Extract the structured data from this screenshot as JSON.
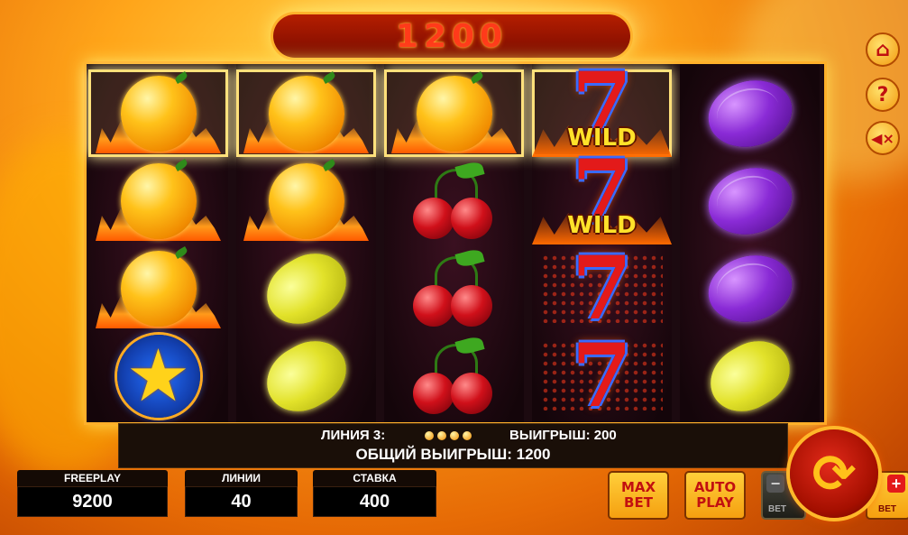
{
  "top_win": "1200",
  "reels": [
    [
      "orange-fire",
      "orange-fire",
      "orange-fire",
      "star"
    ],
    [
      "orange-fire",
      "orange-fire",
      "lemon",
      "lemon"
    ],
    [
      "orange-fire",
      "cherry",
      "cherry",
      "cherry"
    ],
    [
      "seven-wild",
      "seven-wild",
      "seven",
      "seven"
    ],
    [
      "plum",
      "plum",
      "plum",
      "lemon"
    ]
  ],
  "highlighted_row": 0,
  "wild_label": "WILD",
  "info": {
    "line_label": "ЛИНИЯ 3:",
    "line_win": "ВЫИГРЫШ: 200",
    "total_win": "ОБЩИЙ ВЫИГРЫШ: 1200"
  },
  "stats": {
    "freeplay_label": "FREEPLAY",
    "freeplay_value": "9200",
    "lines_label": "ЛИНИИ",
    "lines_value": "40",
    "bet_label": "СТАВКА",
    "bet_value": "400"
  },
  "buttons": {
    "max_bet_1": "MAX",
    "max_bet_2": "BET",
    "auto_play_1": "AUTO",
    "auto_play_2": "PLAY",
    "bet_minus": "BET",
    "bet_plus": "BET"
  },
  "icons": {
    "home": "home-icon",
    "help": "help-icon",
    "sound": "sound-off-icon",
    "spin": "spin-icon"
  }
}
